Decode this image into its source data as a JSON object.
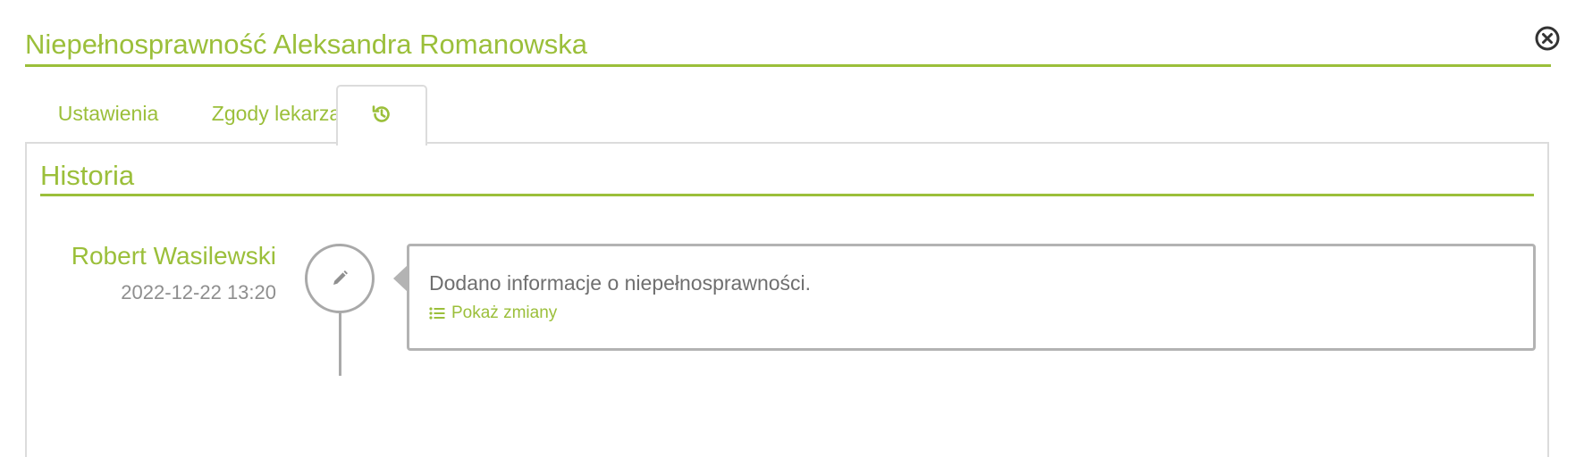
{
  "header": {
    "title": "Niepełnosprawność Aleksandra Romanowska"
  },
  "icons": {
    "close": "close-circle-icon",
    "history": "history-icon",
    "edit": "pencil-icon",
    "changes": "list-icon"
  },
  "tabs": [
    {
      "label": "Ustawienia"
    },
    {
      "label": "Zgody lekarza"
    },
    {
      "label": "",
      "icon": "history-icon",
      "active": true
    }
  ],
  "history": {
    "title": "Historia",
    "entries": [
      {
        "user": "Robert Wasilewski",
        "timestamp": "2022-12-22 13:20",
        "message": "Dodano informacje o niepełnosprawności.",
        "link_label": "Pokaż zmiany"
      }
    ]
  },
  "colors": {
    "accent": "#9bbf3a",
    "muted_text": "#6f6f6f",
    "border": "#dcdcdc"
  }
}
